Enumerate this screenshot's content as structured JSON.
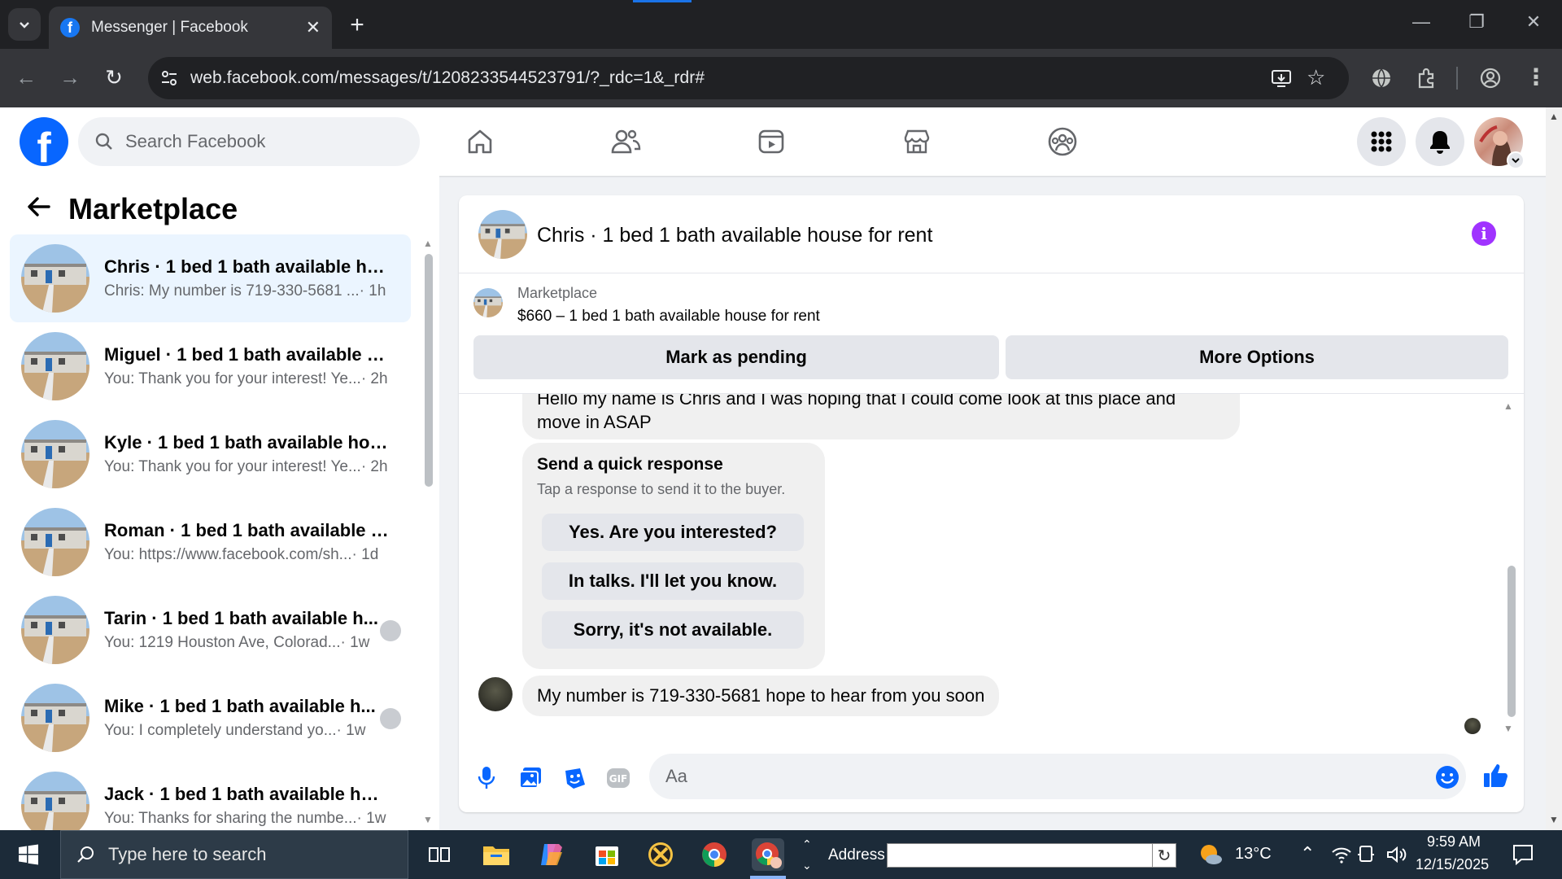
{
  "browser": {
    "tab_title": "Messenger | Facebook",
    "tab_close": "✕",
    "new_tab": "+",
    "url": "web.facebook.com/messages/t/1208233544523791/?_rdc=1&_rdr#",
    "window_controls": {
      "minimize": "—",
      "restore": "❐",
      "close": "✕"
    }
  },
  "facebook": {
    "search_placeholder": "Search Facebook",
    "logo_letter": "f"
  },
  "sidebar": {
    "title": "Marketplace",
    "conversations": [
      {
        "name": "Chris · 1 bed 1 bath available ho...",
        "preview": "Chris: My number is 719-330-5681 ...",
        "time": " · 1h",
        "active": true,
        "read_receipt": false
      },
      {
        "name": "Miguel · 1 bed 1 bath available h...",
        "preview": "You: Thank you for your interest! Ye...",
        "time": " · 2h",
        "active": false,
        "read_receipt": false
      },
      {
        "name": "Kyle · 1 bed 1 bath available hou...",
        "preview": "You: Thank you for your interest! Ye...",
        "time": " · 2h",
        "active": false,
        "read_receipt": false
      },
      {
        "name": "Roman · 1 bed 1 bath available h...",
        "preview": "You: https://www.facebook.com/sh...",
        "time": " · 1d",
        "active": false,
        "read_receipt": false
      },
      {
        "name": "Tarin · 1 bed 1 bath available h...",
        "preview": "You: 1219 Houston Ave, Colorad...",
        "time": " · 1w",
        "active": false,
        "read_receipt": true
      },
      {
        "name": "Mike · 1 bed 1 bath available h...",
        "preview": "You: I completely understand yo...",
        "time": " · 1w",
        "active": false,
        "read_receipt": true
      },
      {
        "name": "Jack · 1 bed 1 bath available hou...",
        "preview": "You: Thanks for sharing the numbe...",
        "time": " · 1w",
        "active": false,
        "read_receipt": false
      }
    ]
  },
  "chat": {
    "title": "Chris · 1 bed 1 bath available house for rent",
    "listing_label": "Marketplace",
    "listing_price_title": "$660 – 1 bed 1 bath available house for rent",
    "mark_pending": "Mark as pending",
    "more_options": "More Options",
    "messages": {
      "first_line1": "Hello my name is Chris and I was hoping that I could come look at this place and",
      "first_line2": "move in ASAP",
      "quick_title": "Send a quick response",
      "quick_subtitle": "Tap a response to send it to the buyer.",
      "quick_replies": [
        "Yes. Are you interested?",
        "In talks. I'll let you know.",
        "Sorry, it's not available."
      ],
      "last": "My number is 719-330-5681 hope to hear from you soon"
    },
    "composer_placeholder": "Aa"
  },
  "taskbar": {
    "search_placeholder": "Type here to search",
    "address_label": "Address",
    "weather": "13°C",
    "time": "9:59 AM",
    "date": "12/15/2025"
  },
  "colors": {
    "fb_blue": "#0866ff",
    "active_conv": "#ebf5ff",
    "info_purple": "#a033ff",
    "taskbar": "#1c2b39"
  }
}
